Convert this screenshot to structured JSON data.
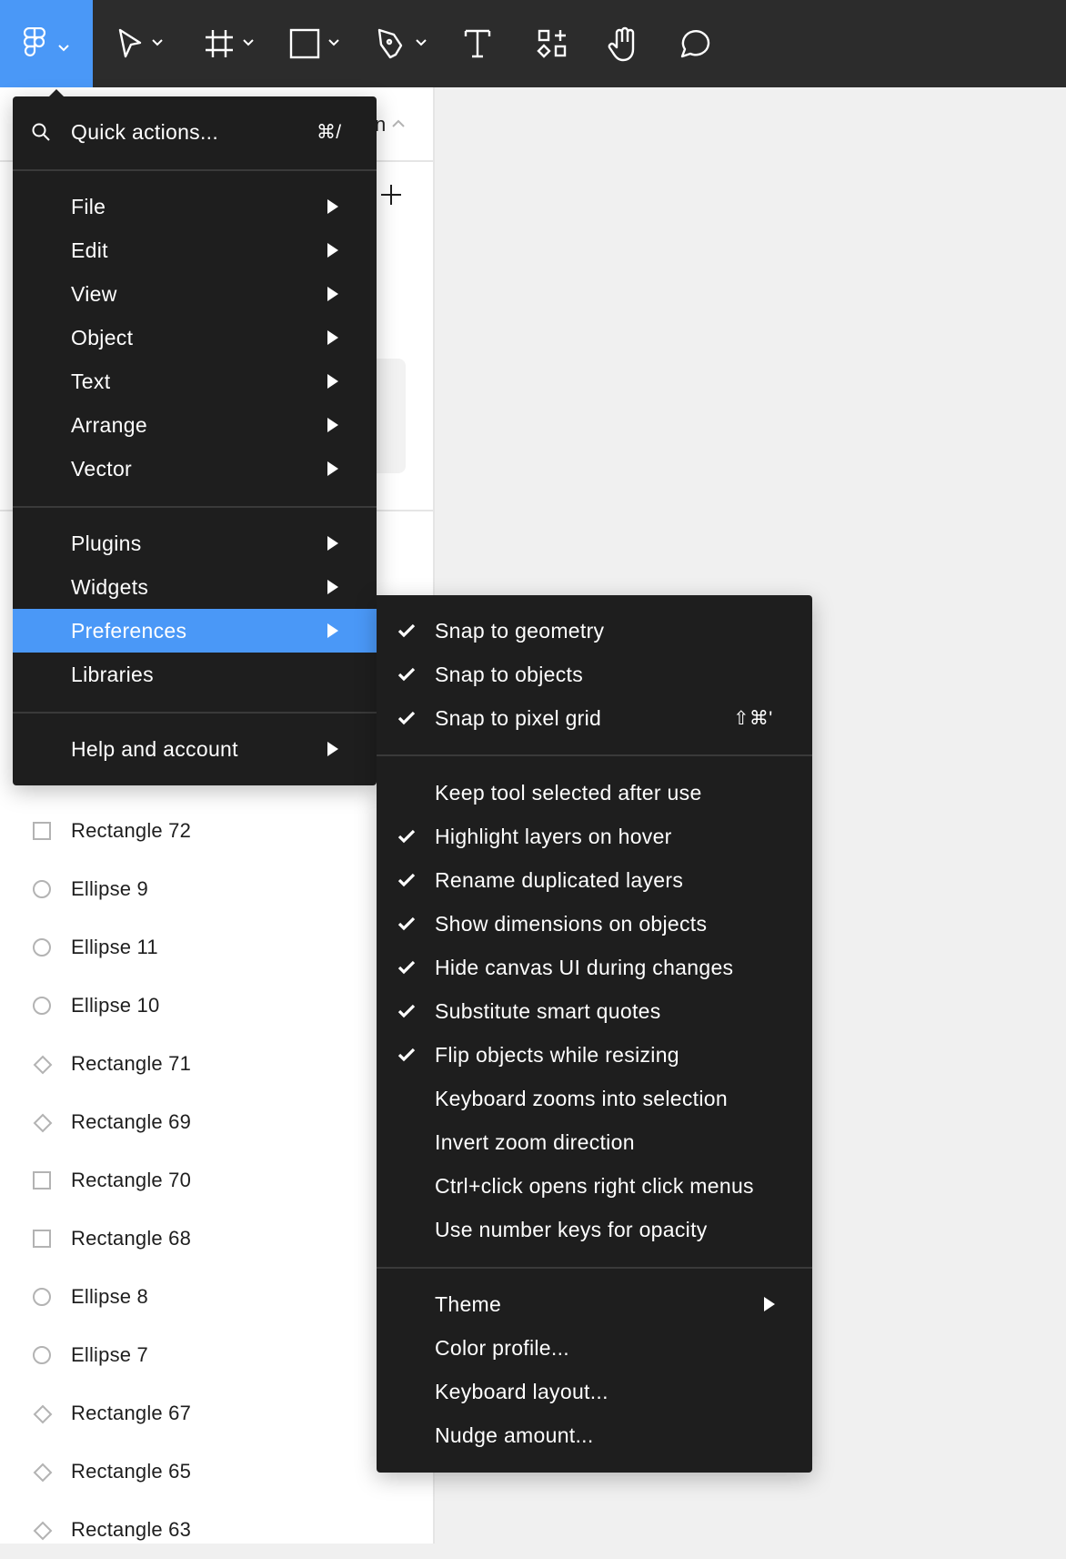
{
  "toolbar": {
    "logo": "figma-logo-icon",
    "tools": [
      {
        "name": "move-tool",
        "has_dropdown": true
      },
      {
        "name": "frame-tool",
        "has_dropdown": true
      },
      {
        "name": "shape-tool",
        "has_dropdown": true
      },
      {
        "name": "pen-tool",
        "has_dropdown": true
      },
      {
        "name": "text-tool",
        "has_dropdown": false
      },
      {
        "name": "resources-tool",
        "has_dropdown": false
      },
      {
        "name": "hand-tool",
        "has_dropdown": false
      },
      {
        "name": "comment-tool",
        "has_dropdown": false
      }
    ],
    "accent_color": "#4a98f7"
  },
  "sidebar": {
    "page_title_fragment": "n",
    "layers": [
      {
        "name": "Rectangle 72",
        "icon": "rectangle"
      },
      {
        "name": "Ellipse 9",
        "icon": "ellipse"
      },
      {
        "name": "Ellipse 11",
        "icon": "ellipse"
      },
      {
        "name": "Ellipse 10",
        "icon": "ellipse"
      },
      {
        "name": "Rectangle 71",
        "icon": "diamond"
      },
      {
        "name": "Rectangle 69",
        "icon": "diamond"
      },
      {
        "name": "Rectangle 70",
        "icon": "rectangle"
      },
      {
        "name": "Rectangle 68",
        "icon": "rectangle"
      },
      {
        "name": "Ellipse 8",
        "icon": "ellipse"
      },
      {
        "name": "Ellipse 7",
        "icon": "ellipse"
      },
      {
        "name": "Rectangle 67",
        "icon": "diamond"
      },
      {
        "name": "Rectangle 65",
        "icon": "diamond"
      },
      {
        "name": "Rectangle 63",
        "icon": "diamond"
      }
    ]
  },
  "main_menu": {
    "quick_actions": {
      "label": "Quick actions...",
      "shortcut": "⌘/"
    },
    "group1": [
      {
        "label": "File",
        "submenu": true
      },
      {
        "label": "Edit",
        "submenu": true
      },
      {
        "label": "View",
        "submenu": true
      },
      {
        "label": "Object",
        "submenu": true
      },
      {
        "label": "Text",
        "submenu": true
      },
      {
        "label": "Arrange",
        "submenu": true
      },
      {
        "label": "Vector",
        "submenu": true
      }
    ],
    "group2": [
      {
        "label": "Plugins",
        "submenu": true
      },
      {
        "label": "Widgets",
        "submenu": true
      },
      {
        "label": "Preferences",
        "submenu": true,
        "active": true
      },
      {
        "label": "Libraries",
        "submenu": false
      }
    ],
    "group3": [
      {
        "label": "Help and account",
        "submenu": true
      }
    ]
  },
  "preferences_menu": {
    "group1": [
      {
        "label": "Snap to geometry",
        "checked": true
      },
      {
        "label": "Snap to objects",
        "checked": true
      },
      {
        "label": "Snap to pixel grid",
        "checked": true,
        "shortcut": "⇧⌘'"
      }
    ],
    "group2": [
      {
        "label": "Keep tool selected after use",
        "checked": false
      },
      {
        "label": "Highlight layers on hover",
        "checked": true
      },
      {
        "label": "Rename duplicated layers",
        "checked": true
      },
      {
        "label": "Show dimensions on objects",
        "checked": true
      },
      {
        "label": "Hide canvas UI during changes",
        "checked": true
      },
      {
        "label": "Substitute smart quotes",
        "checked": true
      },
      {
        "label": "Flip objects while resizing",
        "checked": true
      },
      {
        "label": "Keyboard zooms into selection",
        "checked": false
      },
      {
        "label": "Invert zoom direction",
        "checked": false
      },
      {
        "label": "Ctrl+click opens right click menus",
        "checked": false
      },
      {
        "label": "Use number keys for opacity",
        "checked": false
      }
    ],
    "group3": [
      {
        "label": "Theme",
        "submenu": true
      },
      {
        "label": "Color profile...",
        "submenu": false
      },
      {
        "label": "Keyboard layout...",
        "submenu": false
      },
      {
        "label": "Nudge amount...",
        "submenu": false
      }
    ]
  }
}
